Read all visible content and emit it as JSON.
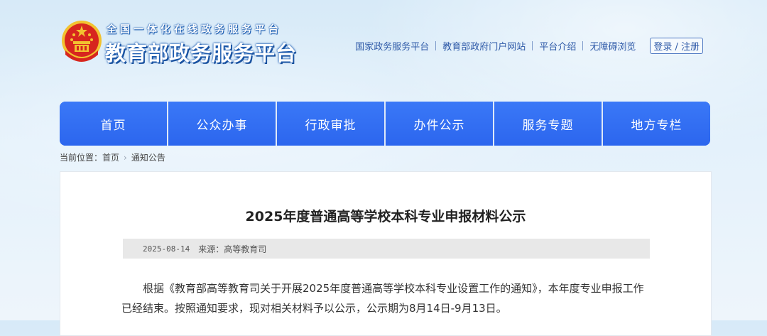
{
  "header": {
    "subtitle": "全国一体化在线政务服务平台",
    "title": "教育部政务服务平台",
    "links": [
      {
        "label": "国家政务服务平台"
      },
      {
        "label": "教育部政府门户网站"
      },
      {
        "label": "平台介绍"
      },
      {
        "label": "无障碍浏览"
      }
    ],
    "login_label": "登录 / 注册"
  },
  "nav": {
    "items": [
      {
        "label": "首页"
      },
      {
        "label": "公众办事"
      },
      {
        "label": "行政审批"
      },
      {
        "label": "办件公示"
      },
      {
        "label": "服务专题"
      },
      {
        "label": "地方专栏"
      }
    ]
  },
  "breadcrumb": {
    "prefix": "当前位置：",
    "items": [
      {
        "label": "首页"
      },
      {
        "label": "通知公告"
      }
    ]
  },
  "article": {
    "title": "2025年度普通高等学校本科专业申报材料公示",
    "date": "2025-08-14",
    "source_label": "来源：",
    "source": "高等教育司",
    "body": "根据《教育部高等教育司关于开展2025年度普通高等学校本科专业设置工作的通知》，本年度专业申报工作已经结束。按照通知要求，现对相关材料予以公示，公示期为8月14日-9月13日。"
  },
  "colors": {
    "nav_blue": "#2f6bf2",
    "link_blue": "#2f5aa8",
    "emblem_red": "#d7261e",
    "emblem_gold": "#f2c230"
  },
  "icons": {
    "emblem": "national-emblem-icon",
    "breadcrumb_separator": "chevron-right-icon"
  }
}
